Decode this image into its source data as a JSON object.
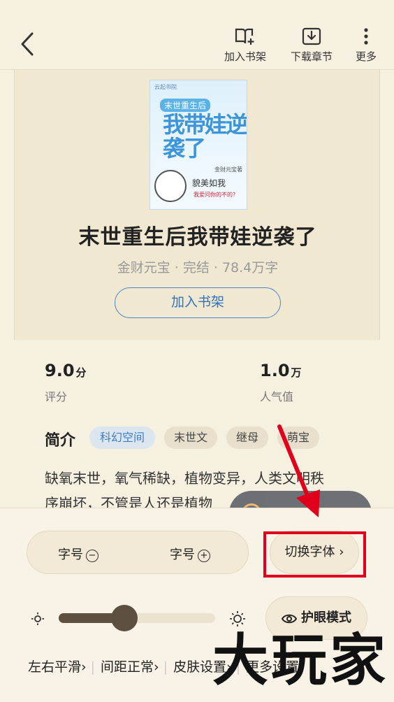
{
  "toolbar": {
    "add_shelf": "加入书架",
    "download": "下载章节",
    "more": "更多"
  },
  "cover": {
    "publisher": "云起书院",
    "series_title": "末世重生后",
    "big_title": "我带娃逆袭了",
    "author_tag": "金财元宝著",
    "slogan": "貌美如我",
    "subline": "我爱问你的不的?"
  },
  "book": {
    "title": "末世重生后我带娃逆袭了",
    "meta": "金财元宝 · 完结 · 78.4万字",
    "add_button": "加入书架"
  },
  "stats": {
    "rating_value": "9.0",
    "rating_unit": "分",
    "rating_label": "评分",
    "popularity_value": "1.0",
    "popularity_unit": "万",
    "popularity_label": "人气值"
  },
  "intro": {
    "heading": "简介",
    "tags": [
      "科幻空间",
      "末世文",
      "继母",
      "萌宝"
    ],
    "line1": "缺氧末世，氧气稀缺，植物变异，人类文明秩",
    "line2": "序崩坏，不管是人还是植物"
  },
  "settings": {
    "font_size_minus": "字号",
    "font_size_plus": "字号",
    "switch_font": "切换字体",
    "brightness_level": 0.42,
    "eye_mode": "护眼模式",
    "page_turn": "左右平滑",
    "spacing": "间距正常",
    "skin": "皮肤设置",
    "more_settings": "更多设置"
  },
  "watermark": "大玩家",
  "colors": {
    "background": "#f6f0e0",
    "accent_blue": "#2f74c0",
    "highlight_red": "#e1001b",
    "slider": "#5e5040"
  }
}
